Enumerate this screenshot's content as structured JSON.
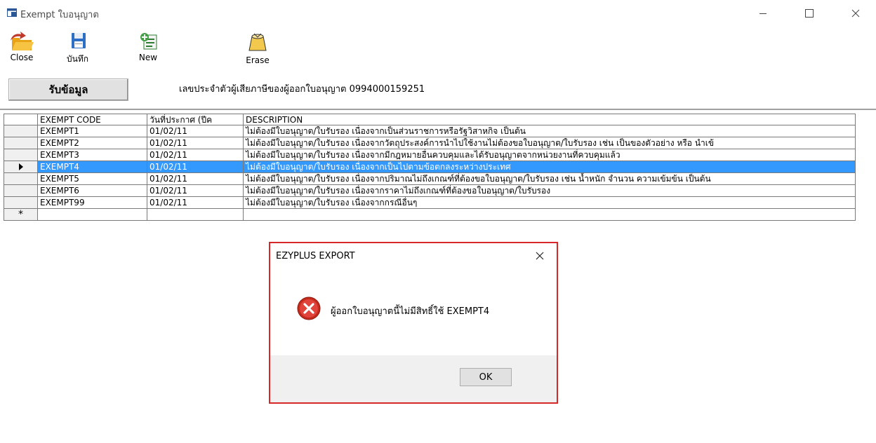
{
  "window": {
    "title": "Exempt ใบอนุญาต"
  },
  "toolbar": {
    "close_label": "Close",
    "save_label": "บันทึก",
    "new_label": "New",
    "erase_label": "Erase"
  },
  "fetch_button": {
    "label": "รับข้อมูล"
  },
  "tax_id_text": "เลขประจำตัวผู้เสียภาษีของผู้ออกใบอนุญาต 0994000159251",
  "grid": {
    "columns": [
      "EXEMPT CODE",
      "วันที่ประกาศ (ปีค",
      "DESCRIPTION"
    ],
    "rows": [
      {
        "code": "EXEMPT1",
        "date": "01/02/11",
        "desc": "ไม่ต้องมีใบอนุญาต/ใบรับรอง เนื่องจากเป็นส่วนราชการหรือรัฐวิสาหกิจ เป็นต้น"
      },
      {
        "code": "EXEMPT2",
        "date": "01/02/11",
        "desc": "ไม่ต้องมีใบอนุญาต/ใบรับรอง เนื่องจากวัตถุประสงค์การนำไปใช้งานไม่ต้องขอใบอนุญาต/ใบรับรอง เช่น เป็นของตัวอย่าง หรือ นำเข้"
      },
      {
        "code": "EXEMPT3",
        "date": "01/02/11",
        "desc": "ไม่ต้องมีใบอนุญาต/ใบรับรอง เนื่องจากมีกฎหมายอื่นควบคุมและได้รับอนุญาตจากหน่วยงานที่ควบคุมแล้ว"
      },
      {
        "code": "EXEMPT4",
        "date": "01/02/11",
        "desc": "ไม่ต้องมีใบอนุญาต/ใบรับรอง เนื่องจากเป็นไปตามข้อตกลงระหว่างประเทศ"
      },
      {
        "code": "EXEMPT5",
        "date": "01/02/11",
        "desc": "ไม่ต้องมีใบอนุญาต/ใบรับรอง เนื่องจากปริมาณไม่ถึงเกณฑ์ที่ต้องขอใบอนุญาต/ใบรับรอง เช่น น้ำหนัก จำนวน ความเข้มข้น เป็นต้น"
      },
      {
        "code": "EXEMPT6",
        "date": "01/02/11",
        "desc": "ไม่ต้องมีใบอนุญาต/ใบรับรอง เนื่องจากราคาไม่ถึงเกณฑ์ที่ต้องขอใบอนุญาต/ใบรับรอง"
      },
      {
        "code": "EXEMPT99",
        "date": "01/02/11",
        "desc": "ไม่ต้องมีใบอนุญาต/ใบรับรอง เนื่องจากกรณีอื่นๆ"
      }
    ],
    "selected_row_index": 3,
    "new_row_marker": "*"
  },
  "dialog": {
    "title": "EZYPLUS EXPORT",
    "message": "ผู้ออกใบอนุญาตนี้ไม่มีสิทธิ์ใช้ EXEMPT4",
    "ok_label": "OK",
    "icon": "error-icon"
  },
  "colors": {
    "selection": "#3399ff",
    "dialog_border": "#d62828",
    "error_icon": "#c42b1c"
  }
}
